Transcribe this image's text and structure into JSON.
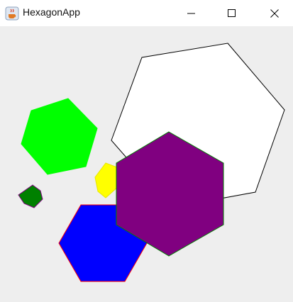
{
  "window": {
    "title": "HexagonApp",
    "app_icon": "java-coffee-cup-icon",
    "controls": {
      "minimize_icon": "minimize-icon",
      "maximize_icon": "maximize-icon",
      "close_icon": "close-icon"
    }
  },
  "canvas": {
    "background": "#eeeeee",
    "hexagons": [
      {
        "name": "white-hexagon",
        "fill": "#ffffff",
        "stroke": "#000000"
      },
      {
        "name": "green-hexagon",
        "fill": "#00ff00",
        "stroke": "#00ff00"
      },
      {
        "name": "yellow-hexagon",
        "fill": "#ffff00",
        "stroke": "#e6e600"
      },
      {
        "name": "dark-green-hexagon",
        "fill": "#008000",
        "stroke": "#800080"
      },
      {
        "name": "blue-hexagon",
        "fill": "#0000ff",
        "stroke": "#ff0000"
      },
      {
        "name": "purple-hexagon",
        "fill": "#800080",
        "stroke": "#008000"
      }
    ]
  }
}
